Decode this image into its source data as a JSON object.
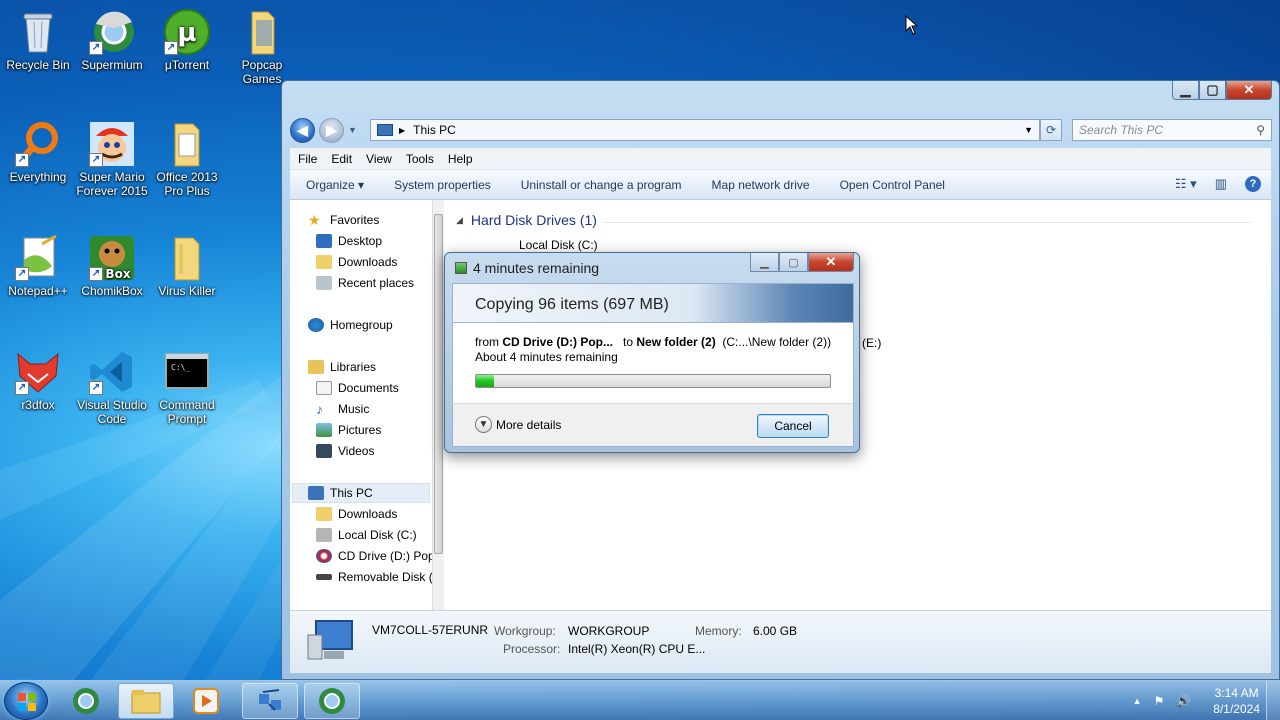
{
  "desktop": {
    "icons": [
      {
        "label": "Recycle Bin",
        "icon": "recycle-bin-icon"
      },
      {
        "label": "Supermium",
        "icon": "supermium-icon"
      },
      {
        "label": "μTorrent",
        "icon": "utorrent-icon"
      },
      {
        "label": "Popcap Games",
        "icon": "folder-icon"
      },
      {
        "label": "Everything",
        "icon": "everything-search-icon"
      },
      {
        "label": "Super Mario Forever 2015",
        "icon": "mario-icon"
      },
      {
        "label": "Office 2013 Pro Plus",
        "icon": "folder-icon"
      },
      {
        "label": "Notepad++",
        "icon": "notepadpp-icon"
      },
      {
        "label": "ChomikBox",
        "icon": "chomikbox-icon"
      },
      {
        "label": "Virus Killer",
        "icon": "folder-icon"
      },
      {
        "label": "r3dfox",
        "icon": "r3dfox-icon"
      },
      {
        "label": "Visual Studio Code",
        "icon": "vscode-icon"
      },
      {
        "label": "Command Prompt",
        "icon": "cmd-icon"
      }
    ],
    "cmd_glyph": "C:\\_",
    "box_text": "Box"
  },
  "explorer": {
    "address": "This PC",
    "search_placeholder": "Search This PC",
    "menu": [
      "File",
      "Edit",
      "View",
      "Tools",
      "Help"
    ],
    "commands": [
      "Organize ▾",
      "System properties",
      "Uninstall or change a program",
      "Map network drive",
      "Open Control Panel"
    ],
    "nav": {
      "favorites": "Favorites",
      "desktop": "Desktop",
      "downloads": "Downloads",
      "recent": "Recent places",
      "homegroup": "Homegroup",
      "libraries": "Libraries",
      "documents": "Documents",
      "music": "Music",
      "pictures": "Pictures",
      "videos": "Videos",
      "thispc": "This PC",
      "pc_downloads": "Downloads",
      "local_disk": "Local Disk (C:)",
      "cd_drive": "CD Drive (D:) Pop",
      "removable": "Removable Disk ("
    },
    "content": {
      "group_title": "Hard Disk Drives (1)",
      "local_disk": "Local Disk (C:)",
      "partial_e": "(E:)"
    },
    "details": {
      "computer_name": "VM7COLL-57ERUNR",
      "workgroup_label": "Workgroup:",
      "workgroup_value": "WORKGROUP",
      "memory_label": "Memory:",
      "memory_value": "6.00 GB",
      "processor_label": "Processor:",
      "processor_value": "Intel(R) Xeon(R) CPU E..."
    }
  },
  "dialog": {
    "title": "4 minutes remaining",
    "header": "Copying 96 items (697 MB)",
    "from_prefix": "from ",
    "from_source": "CD Drive (D:) Pop...",
    "to_prefix": "to ",
    "to_target": "New folder (2)",
    "to_path": "(C:...\\New folder (2))",
    "remaining": "About 4 minutes remaining",
    "progress_percent": 5,
    "more_details": "More details",
    "cancel": "Cancel"
  },
  "taskbar": {
    "time": "3:14 AM",
    "date": "8/1/2024"
  }
}
